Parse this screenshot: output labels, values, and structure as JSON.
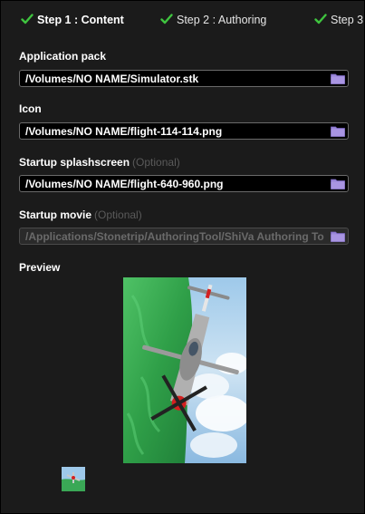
{
  "steps": [
    {
      "label": "Step 1 : Content"
    },
    {
      "label": "Step 2 : Authoring"
    },
    {
      "label": "Step 3"
    }
  ],
  "fields": {
    "app_pack": {
      "label": "Application pack",
      "value": "/Volumes/NO NAME/Simulator.stk"
    },
    "icon": {
      "label": "Icon",
      "value": "/Volumes/NO NAME/flight-114-114.png"
    },
    "splash": {
      "label": "Startup splashscreen",
      "optional": "(Optional)",
      "value": "/Volumes/NO NAME/flight-640-960.png"
    },
    "movie": {
      "label": "Startup movie",
      "optional": "(Optional)",
      "placeholder": "/Applications/Stonetrip/AuthoringTool/ShiVa Authoring Tool"
    }
  },
  "preview": {
    "label": "Preview"
  },
  "colors": {
    "check": "#3fc43f",
    "folder": "#9a86d8",
    "background": "#1b1b1b"
  },
  "icons": [
    "check-icon",
    "folder-icon"
  ]
}
